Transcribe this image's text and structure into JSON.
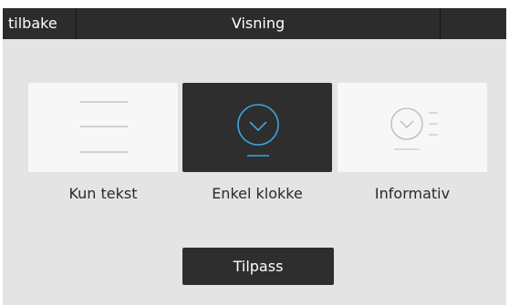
{
  "header": {
    "back_label": "tilbake",
    "title": "Visning"
  },
  "display_options": [
    {
      "label": "Kun tekst",
      "selected": false,
      "icon": "text-lines-icon"
    },
    {
      "label": "Enkel klokke",
      "selected": true,
      "icon": "clock-icon"
    },
    {
      "label": "Informativ",
      "selected": false,
      "icon": "clock-with-info-icon"
    }
  ],
  "actions": {
    "customize_label": "Tilpass"
  },
  "colors": {
    "topbar": "#2c2c2c",
    "background": "#e4e4e4",
    "tile": "#f7f7f7",
    "tile_selected": "#2e2e2e",
    "accent": "#3aa3dd"
  }
}
